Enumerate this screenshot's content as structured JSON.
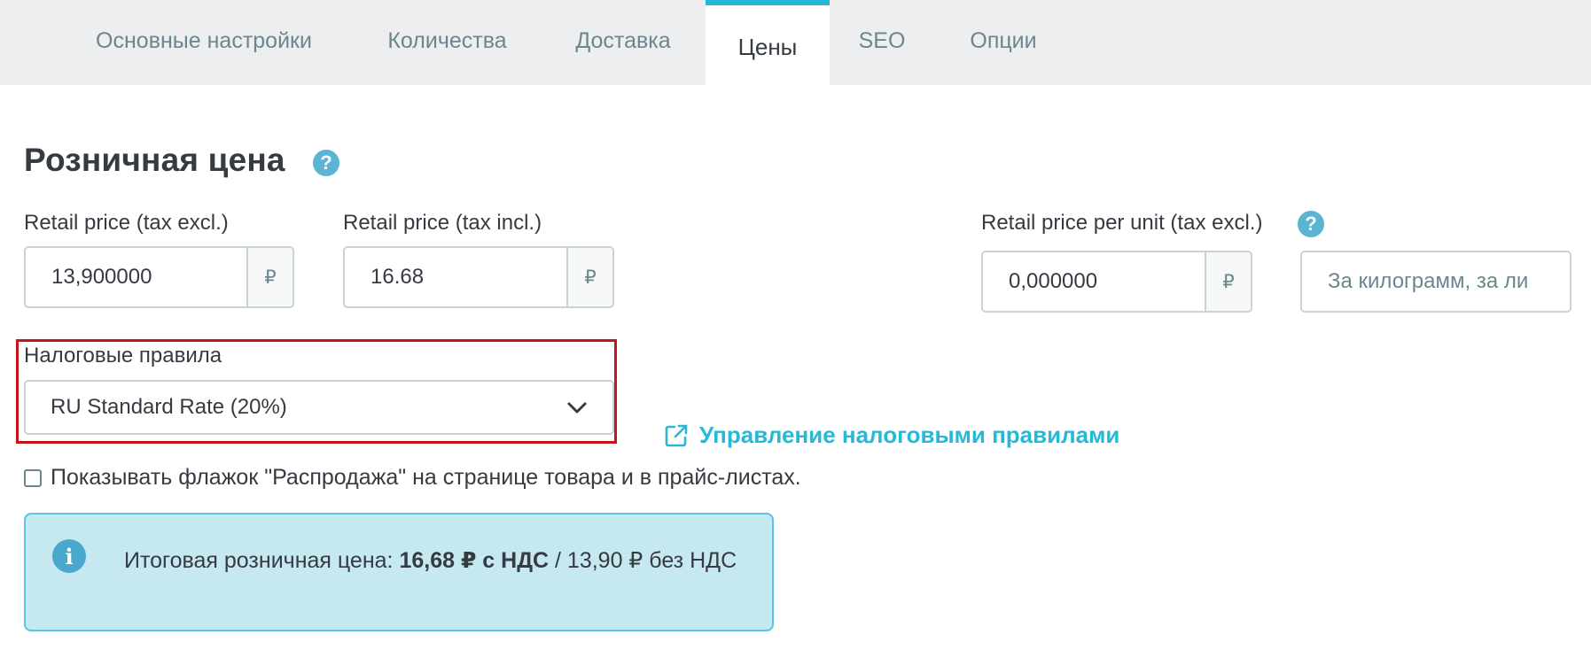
{
  "tabs": [
    {
      "label": "Основные настройки",
      "active": false
    },
    {
      "label": "Количества",
      "active": false
    },
    {
      "label": "Доставка",
      "active": false
    },
    {
      "label": "Цены",
      "active": true
    },
    {
      "label": "SEO",
      "active": false
    },
    {
      "label": "Опции",
      "active": false
    }
  ],
  "section": {
    "title": "Розничная цена",
    "help_icon": "?"
  },
  "fields": {
    "price_tax_excl": {
      "label": "Retail price (tax excl.)",
      "value": "13,900000",
      "currency": "₽"
    },
    "price_tax_incl": {
      "label": "Retail price (tax incl.)",
      "value": "16.68",
      "currency": "₽"
    },
    "unit_price": {
      "label": "Retail price per unit (tax excl.)",
      "value": "0,000000",
      "currency": "₽",
      "help_icon": "?"
    },
    "unity": {
      "placeholder": "За килограмм, за ли"
    }
  },
  "tax_rules": {
    "label": "Налоговые правила",
    "selected": "RU Standard Rate (20%)",
    "manage_link": "Управление налоговыми правилами"
  },
  "on_sale": {
    "label": "Показывать флажок \"Распродажа\" на странице товара и в прайс-листах.",
    "checked": false
  },
  "summary": {
    "icon": "i",
    "prefix": "Итоговая розничная цена:",
    "price_incl": "16,68 ₽ с НДС",
    "separator": "/",
    "price_excl": "13,90 ₽ без НДС"
  },
  "colors": {
    "accent": "#25b9d7",
    "highlight_border": "#c4151c",
    "alert_bg": "#c5e8f1",
    "help_icon": "#5cb4d3"
  },
  "icons": {
    "help": "question-circle-icon",
    "external_link": "external-link-icon",
    "chevron": "chevron-down-icon",
    "info": "info-circle-icon"
  }
}
